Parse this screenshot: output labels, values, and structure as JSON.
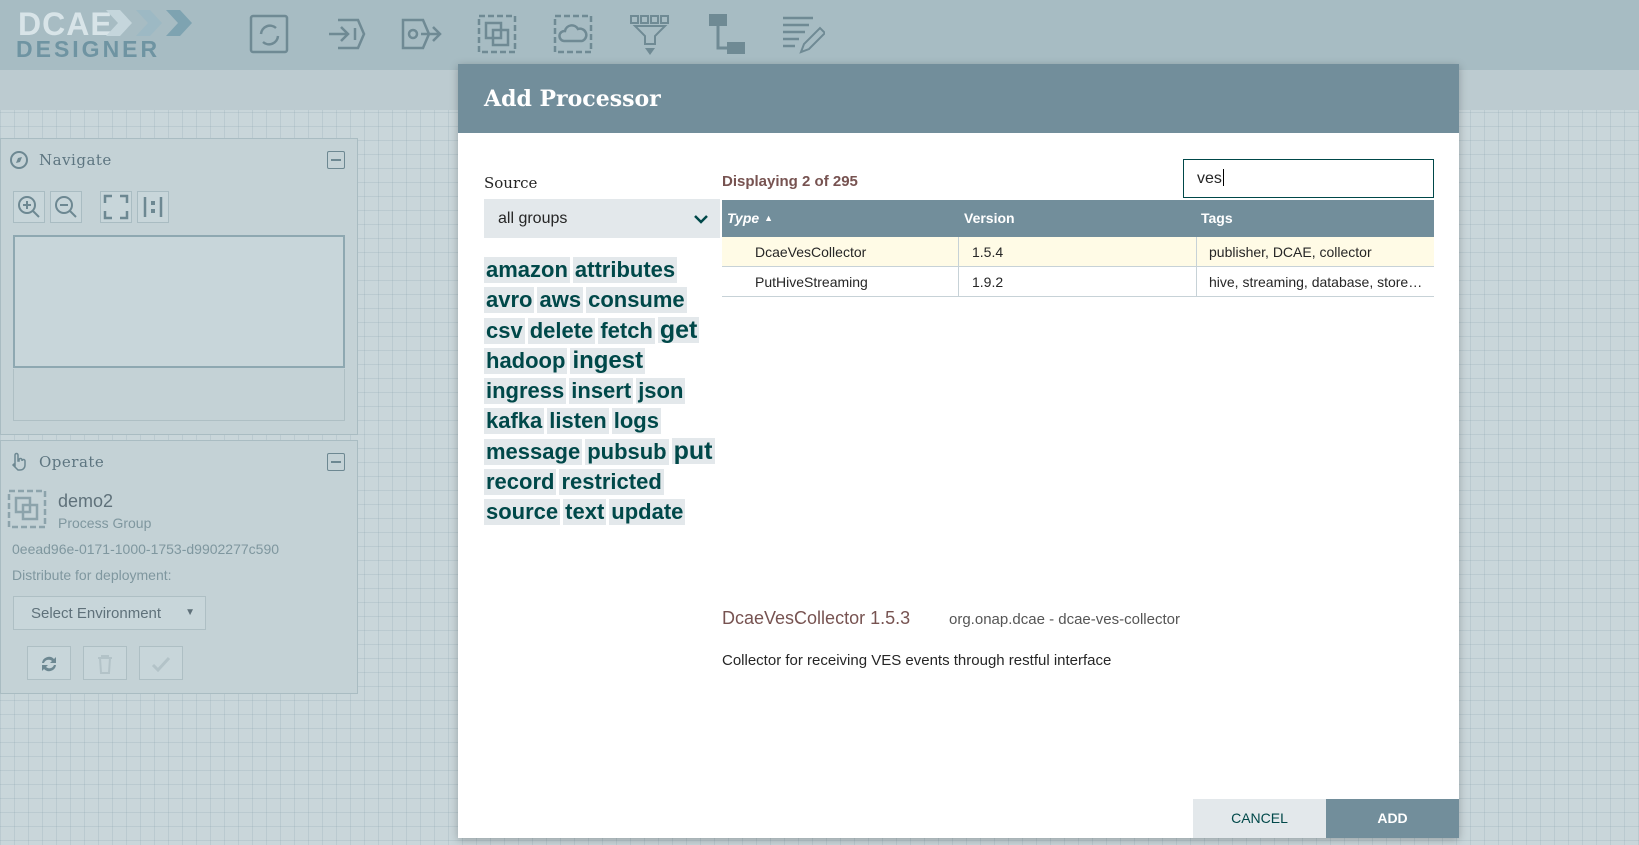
{
  "app": {
    "logo_top": "DCAE",
    "logo_bottom": "DESIGNER"
  },
  "toolbar": {
    "icons": [
      "processor-icon",
      "input-port-icon",
      "output-port-icon",
      "process-group-icon",
      "remote-process-group-icon",
      "funnel-icon",
      "template-icon",
      "label-icon"
    ]
  },
  "navigate": {
    "title": "Navigate"
  },
  "operate": {
    "title": "Operate",
    "name": "demo2",
    "type": "Process Group",
    "id": "0eead96e-0171-1000-1753-d9902277c590",
    "distribute_label": "Distribute for deployment:",
    "environment_select": "Select Environment"
  },
  "dialog": {
    "title": "Add Processor",
    "source_label": "Source",
    "source_value": "all groups",
    "displaying": "Displaying 2 of 295",
    "filter_value": "ves",
    "tags": [
      {
        "text": "amazon",
        "size": 22
      },
      {
        "text": "attributes",
        "size": 22
      },
      {
        "text": "avro",
        "size": 22
      },
      {
        "text": "aws",
        "size": 22
      },
      {
        "text": "consume",
        "size": 22
      },
      {
        "text": "csv",
        "size": 22
      },
      {
        "text": "delete",
        "size": 22
      },
      {
        "text": "fetch",
        "size": 22
      },
      {
        "text": "get",
        "size": 25
      },
      {
        "text": "hadoop",
        "size": 22
      },
      {
        "text": "ingest",
        "size": 24
      },
      {
        "text": "ingress",
        "size": 22
      },
      {
        "text": "insert",
        "size": 22
      },
      {
        "text": "json",
        "size": 22
      },
      {
        "text": "kafka",
        "size": 22
      },
      {
        "text": "listen",
        "size": 22
      },
      {
        "text": "logs",
        "size": 22
      },
      {
        "text": "message",
        "size": 22
      },
      {
        "text": "pubsub",
        "size": 22
      },
      {
        "text": "put",
        "size": 25
      },
      {
        "text": "record",
        "size": 22
      },
      {
        "text": "restricted",
        "size": 22
      },
      {
        "text": "source",
        "size": 22
      },
      {
        "text": "text",
        "size": 22
      },
      {
        "text": "update",
        "size": 22
      }
    ],
    "table": {
      "headers": {
        "type": "Type",
        "version": "Version",
        "tags": "Tags"
      },
      "rows": [
        {
          "type": "DcaeVesCollector",
          "version": "1.5.4",
          "tags": "publisher, DCAE, collector",
          "selected": true
        },
        {
          "type": "PutHiveStreaming",
          "version": "1.9.2",
          "tags": "hive, streaming, database, store…",
          "selected": false
        }
      ]
    },
    "description": {
      "name": "DcaeVesCollector 1.5.3",
      "bundle": "org.onap.dcae - dcae-ves-collector",
      "text": "Collector for receiving VES events through restful interface"
    },
    "cancel_label": "CANCEL",
    "add_label": "ADD"
  }
}
